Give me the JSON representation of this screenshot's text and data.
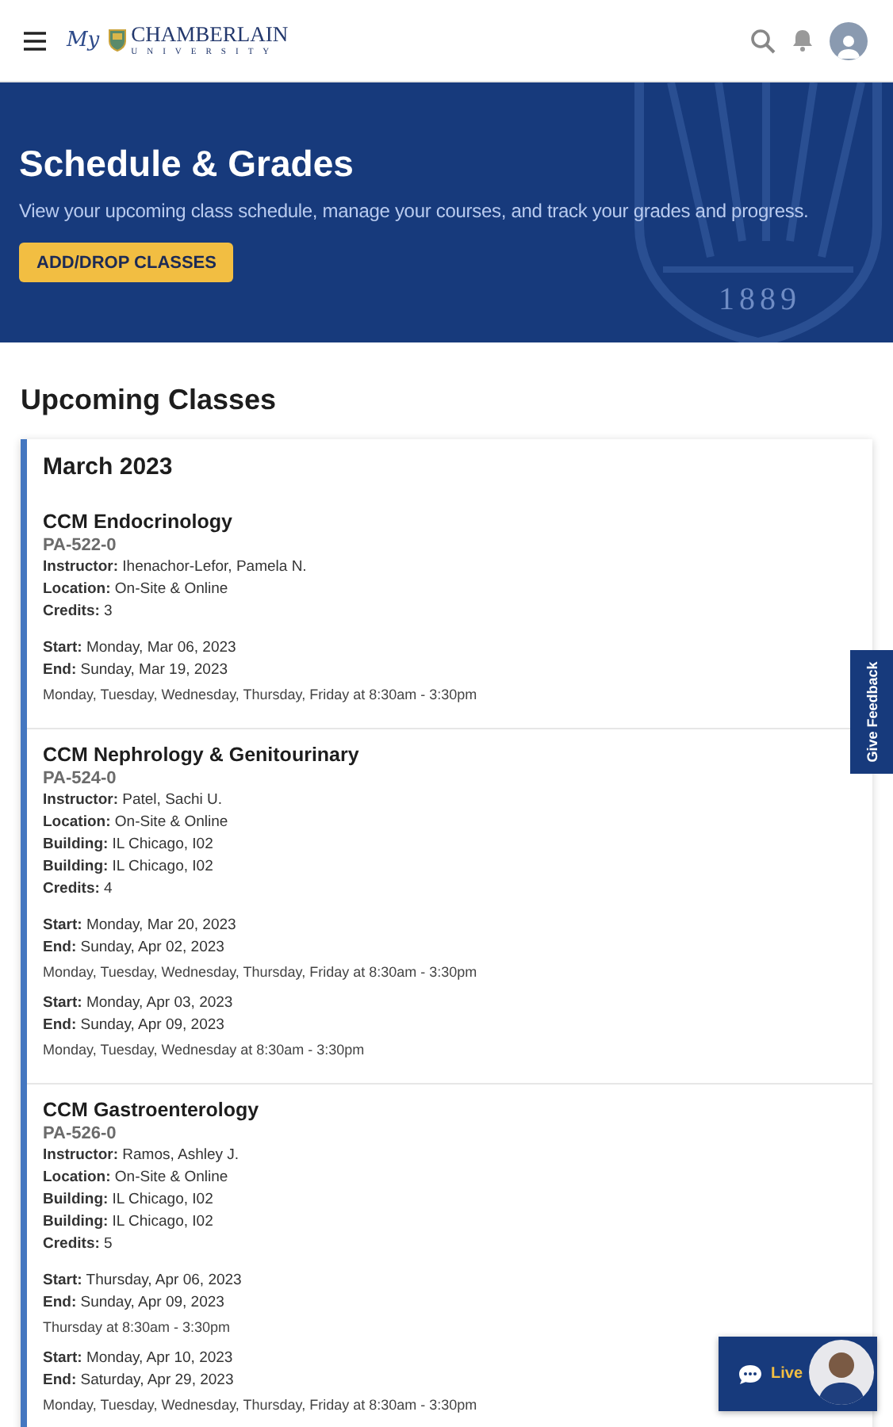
{
  "header": {
    "logo": {
      "script": "My",
      "name": "CHAMBERLAIN",
      "subtitle": "UNIVERSITY"
    }
  },
  "banner": {
    "title": "Schedule & Grades",
    "description": "View your upcoming class schedule, manage your courses, and track your grades and progress.",
    "button": "ADD/DROP CLASSES",
    "crest_year": "1889"
  },
  "section_title": "Upcoming Classes",
  "month": "March 2023",
  "courses": [
    {
      "title": "CCM Endocrinology",
      "code": "PA-522-0",
      "details": [
        {
          "label": "Instructor:",
          "value": "Ihenachor-Lefor, Pamela N."
        },
        {
          "label": "Location:",
          "value": "On-Site & Online"
        },
        {
          "label": "Credits:",
          "value": "3"
        }
      ],
      "sessions": [
        {
          "start_label": "Start:",
          "start": "Monday, Mar 06, 2023",
          "end_label": "End:",
          "end": "Sunday, Mar 19, 2023",
          "schedule": "Monday, Tuesday, Wednesday, Thursday, Friday at 8:30am - 3:30pm"
        }
      ]
    },
    {
      "title": "CCM Nephrology & Genitourinary",
      "code": "PA-524-0",
      "details": [
        {
          "label": "Instructor:",
          "value": "Patel, Sachi U."
        },
        {
          "label": "Location:",
          "value": "On-Site & Online"
        },
        {
          "label": "Building:",
          "value": "IL Chicago, I02"
        },
        {
          "label": "Building:",
          "value": "IL Chicago, I02"
        },
        {
          "label": "Credits:",
          "value": "4"
        }
      ],
      "sessions": [
        {
          "start_label": "Start:",
          "start": "Monday, Mar 20, 2023",
          "end_label": "End:",
          "end": "Sunday, Apr 02, 2023",
          "schedule": "Monday, Tuesday, Wednesday, Thursday, Friday at 8:30am - 3:30pm"
        },
        {
          "start_label": "Start:",
          "start": "Monday, Apr 03, 2023",
          "end_label": "End:",
          "end": "Sunday, Apr 09, 2023",
          "schedule": "Monday, Tuesday, Wednesday at 8:30am - 3:30pm"
        }
      ]
    },
    {
      "title": "CCM Gastroenterology",
      "code": "PA-526-0",
      "details": [
        {
          "label": "Instructor:",
          "value": "Ramos, Ashley J."
        },
        {
          "label": "Location:",
          "value": "On-Site & Online"
        },
        {
          "label": "Building:",
          "value": "IL Chicago, I02"
        },
        {
          "label": "Building:",
          "value": "IL Chicago, I02"
        },
        {
          "label": "Credits:",
          "value": "5"
        }
      ],
      "sessions": [
        {
          "start_label": "Start:",
          "start": "Thursday, Apr 06, 2023",
          "end_label": "End:",
          "end": "Sunday, Apr 09, 2023",
          "schedule": "Thursday at 8:30am - 3:30pm"
        },
        {
          "start_label": "Start:",
          "start": "Monday, Apr 10, 2023",
          "end_label": "End:",
          "end": "Saturday, Apr 29, 2023",
          "schedule": "Monday, Tuesday, Wednesday, Thursday, Friday at 8:30am - 3:30pm"
        }
      ]
    }
  ],
  "feedback_tab": "Give Feedback",
  "chat": {
    "label": "Live"
  }
}
